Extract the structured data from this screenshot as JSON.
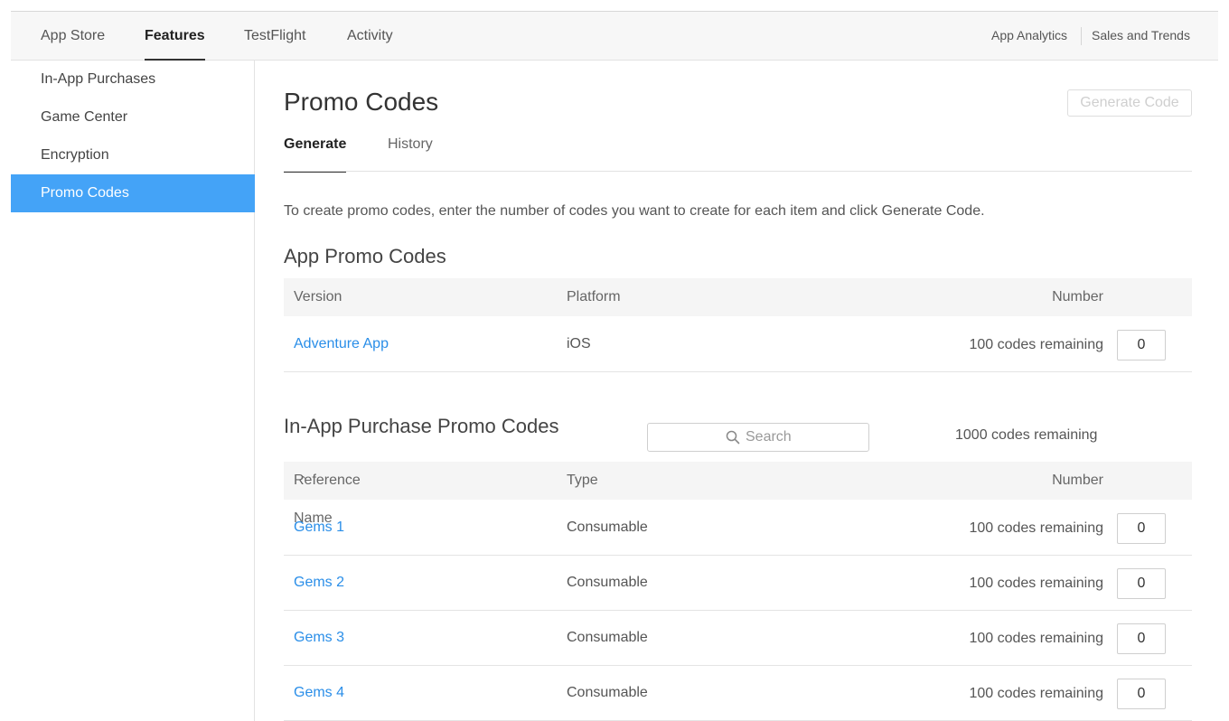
{
  "topnav": {
    "tabs": [
      {
        "label": "App Store"
      },
      {
        "label": "Features"
      },
      {
        "label": "TestFlight"
      },
      {
        "label": "Activity"
      }
    ],
    "links": [
      {
        "label": "App Analytics"
      },
      {
        "label": "Sales and Trends"
      }
    ]
  },
  "sidebar": {
    "items": [
      {
        "label": "In-App Purchases"
      },
      {
        "label": "Game Center"
      },
      {
        "label": "Encryption"
      },
      {
        "label": "Promo Codes"
      }
    ]
  },
  "page": {
    "title": "Promo Codes",
    "generate_button": "Generate Code",
    "subtabs": [
      {
        "label": "Generate"
      },
      {
        "label": "History"
      }
    ],
    "instructions": "To create promo codes, enter the number of codes you want to create for each item and click Generate Code."
  },
  "app_promo": {
    "title": "App Promo Codes",
    "headers": {
      "c1": "Version",
      "c2": "Platform",
      "c3": "Number"
    },
    "rows": [
      {
        "name": "Adventure App",
        "col2": "iOS",
        "remaining": "100 codes remaining",
        "value": "0"
      }
    ]
  },
  "iap_promo": {
    "title": "In-App Purchase Promo Codes",
    "search_placeholder": "Search",
    "remaining": "1000 codes remaining",
    "headers": {
      "c1": "Reference Name",
      "c2": "Type",
      "c3": "Number"
    },
    "rows": [
      {
        "name": "Gems 1",
        "col2": "Consumable",
        "remaining": "100 codes remaining",
        "value": "0"
      },
      {
        "name": "Gems 2",
        "col2": "Consumable",
        "remaining": "100 codes remaining",
        "value": "0"
      },
      {
        "name": "Gems 3",
        "col2": "Consumable",
        "remaining": "100 codes remaining",
        "value": "0"
      },
      {
        "name": "Gems 4",
        "col2": "Consumable",
        "remaining": "100 codes remaining",
        "value": "0"
      }
    ]
  },
  "colors": {
    "accent": "#44a3f7",
    "link": "#2a8ee8"
  }
}
